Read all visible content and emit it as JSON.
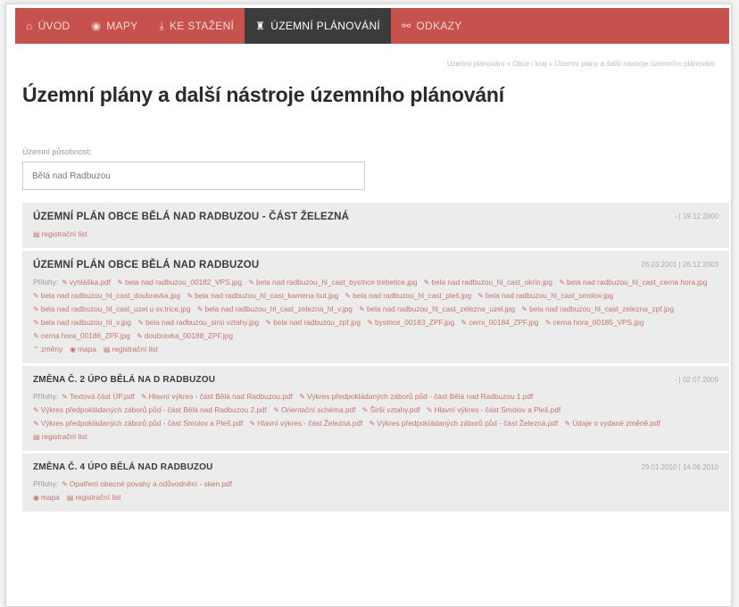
{
  "nav": {
    "items": [
      {
        "label": "ÚVOD",
        "icon": "home-icon",
        "glyph": "⌂"
      },
      {
        "label": "MAPY",
        "icon": "globe-icon",
        "glyph": "◉"
      },
      {
        "label": "KE STAŽENÍ",
        "icon": "download-icon",
        "glyph": "⤓"
      },
      {
        "label": "ÚZEMNÍ PLÁNOVÁNÍ",
        "icon": "binoculars-icon",
        "glyph": "♜"
      },
      {
        "label": "ODKAZY",
        "icon": "link-icon",
        "glyph": "⚯"
      }
    ],
    "active_index": 3
  },
  "breadcrumb": "Územní plánování » Obce i kraj » Územní plány a další nástroje územního plánování",
  "page_title": "Územní plány a další nástroje územního plánování",
  "search": {
    "label": "Územní působnost:",
    "value": "Bělá nad Radbuzou"
  },
  "plans": [
    {
      "title": "ÚZEMNÍ PLÁN OBCE BĚLÁ NAD RADBUZOU - ČÁST ŽELEZNÁ",
      "dates": "- | 19.12.2000",
      "attachments_label": "",
      "attachments": [],
      "actions": [
        {
          "label": "registrační list",
          "icon": "document-icon",
          "glyph": "▤"
        }
      ]
    },
    {
      "title": "ÚZEMNÍ PLÁN OBCE BĚLÁ NAD RADBUZOU",
      "dates": "26.03.2001 | 26.12.2003",
      "attachments_label": "Přílohy:",
      "attachments": [
        "vyhláška.pdf",
        "bela nad radbuzou_00182_VPS.jpg",
        "bela nad radbuzou_hl_cast_bystrice trebetice.jpg",
        "bela nad radbuzou_hl_cast_okrin.jpg",
        "bela nad radbuzou_hl_cast_cerna hora.jpg",
        "bela nad radbuzou_hl_cast_doubravka.jpg",
        "bela nad radbuzou_hl_cast_kamena hut.jpg",
        "bela nad radbuzou_hl_cast_pleš.jpg",
        "bela nad radbuzou_hl_cast_smolov.jpg",
        "bela nad radbuzou_hl_cast_uzel u sv.trice.jpg",
        "bela nad radbuzou_hl_cast_zelezna_hl_v.jpg",
        "bela nad radbuzou_hl_cast_zelezna_uzel.jpg",
        "bela nad radbuzou_hl_cast_zelezna_zpf.jpg",
        "bela nad radbuzou_hl_v.jpg",
        "bela nad radbuzou_sirsi vztahy.jpg",
        "bela nad radbuzou_zpf.jpg",
        "bystrice_00183_ZPF.jpg",
        "cerni_00184_ZPF.jpg",
        "cerna hora_00185_VPS.jpg",
        "cerna hora_00186_ZPF.jpg",
        "doubravka_00188_ZPF.jpg"
      ],
      "actions": [
        {
          "label": "změny",
          "icon": "chevron-up-icon",
          "glyph": "⌃"
        },
        {
          "label": "mapa",
          "icon": "globe-icon",
          "glyph": "◉"
        },
        {
          "label": "registrační list",
          "icon": "document-icon",
          "glyph": "▤"
        }
      ]
    },
    {
      "title": "ZMĚNA Č. 2 ÚPO BĚLÁ NA D RADBUZOU",
      "dates": "- | 02.07.2009",
      "attachments_label": "Přílohy:",
      "attachments": [
        "Textová část ÚP.pdf",
        "Hlavní výkres - část Bělá nad Radbuzou.pdf",
        "Výkres předpokládaných záborů půd - část Bělá nad Radbuzou 1.pdf",
        "Výkres předpokládaných záborů půd - část Bělá nad Radbuzou 2.pdf",
        "Orientační schéma.pdf",
        "Širší vztahy.pdf",
        "Hlavní výkres - část Smolov a Pleš.pdf",
        "Výkres předpokládaných záborů půd - část Smolov a Pleš.pdf",
        "Hlavní výkres - část Železná.pdf",
        "Výkres předpokládaných záborů půd - část Železná.pdf",
        "Údaje o vydané změně.pdf"
      ],
      "actions": [
        {
          "label": "registrační list",
          "icon": "document-icon",
          "glyph": "▤"
        }
      ]
    },
    {
      "title": "ZMĚNA Č. 4 ÚPO BĚLÁ NAD RADBUZOU",
      "dates": "29.01.2010 | 14.08.2010",
      "attachments_label": "Přílohy:",
      "attachments": [
        "Opatření obecné povahy a odůvodnění - sken.pdf"
      ],
      "actions": [
        {
          "label": "mapa",
          "icon": "globe-icon",
          "glyph": "◉"
        },
        {
          "label": "registrační list",
          "icon": "document-icon",
          "glyph": "▤"
        }
      ]
    }
  ]
}
